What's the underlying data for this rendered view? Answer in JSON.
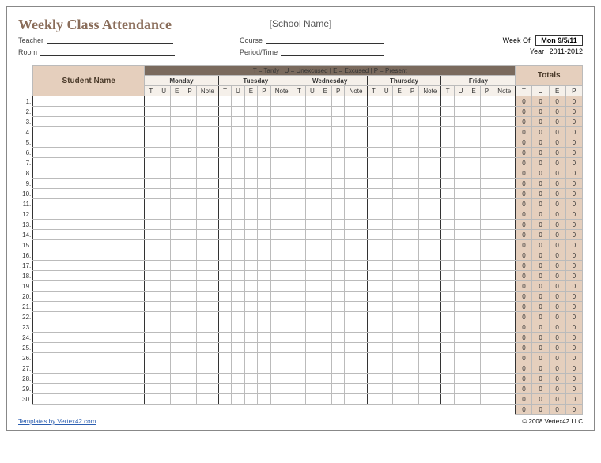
{
  "title": "Weekly Class Attendance",
  "school_name": "[School Name]",
  "labels": {
    "teacher": "Teacher",
    "room": "Room",
    "course": "Course",
    "period": "Period/Time",
    "week_of": "Week Of",
    "year": "Year",
    "student_name": "Student Name",
    "totals": "Totals",
    "note": "Note"
  },
  "week_of_value": "Mon 9/5/11",
  "year_value": "2011-2012",
  "legend": "T = Tardy    |    U = Unexcused    |    E = Excused    |    P = Present",
  "days": [
    "Monday",
    "Tuesday",
    "Wednesday",
    "Thursday",
    "Friday"
  ],
  "codes": [
    "T",
    "U",
    "E",
    "P"
  ],
  "row_count": 30,
  "totals_default": [
    0,
    0,
    0,
    0
  ],
  "grand_totals": [
    0,
    0,
    0,
    0
  ],
  "footer": {
    "link_text": "Templates by Vertex42.com",
    "copyright": "© 2008 Vertex42 LLC"
  }
}
